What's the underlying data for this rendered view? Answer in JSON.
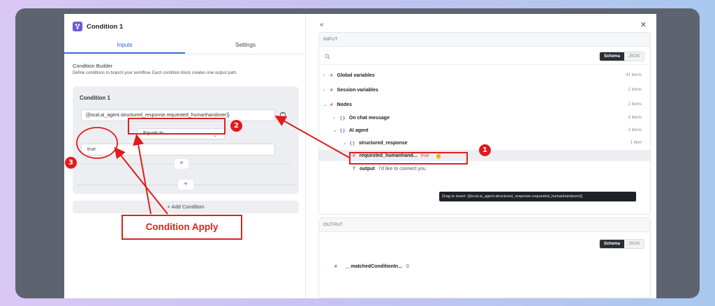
{
  "panel": {
    "title": "Condition 1",
    "tabs": [
      "Inputs",
      "Settings"
    ],
    "section_title": "Condition Builder",
    "section_desc": "Define conditions to branch your workflow. Each condition block creates one output path.",
    "condition_label": "Condition 1",
    "expression_value": "{{local.ai_agent.structured_response.requested_humanhandover}}",
    "operator_value": "Equals to",
    "compare_value": "true",
    "plus": "+",
    "add_condition": "+ Add Condition"
  },
  "input": {
    "header": "INPUT",
    "view_toggle": [
      "Schema",
      "JSON"
    ],
    "tree": [
      {
        "label": "Global variables",
        "count": "41 items"
      },
      {
        "label": "Session variables",
        "count": "2 items"
      },
      {
        "label": "Nodes",
        "count": "2 items"
      },
      {
        "label": "On chat message",
        "count": "4 items"
      },
      {
        "label": "AI agent",
        "count": "2 items"
      },
      {
        "label": "structured_response",
        "count": "1 item"
      },
      {
        "label": "requested_humanhand...",
        "value": "true"
      },
      {
        "label": "output",
        "value": "I'd like to connect you"
      }
    ],
    "tooltip": "Drag to insert: {{local.ai_agent.structured_response.requested_humanhandover}}"
  },
  "output": {
    "header": "OUTPUT",
    "view_toggle": [
      "Schema",
      "JSON"
    ],
    "field_label": "__matchedConditionIn...",
    "field_value": "0"
  },
  "annotations": {
    "badge_1": "1",
    "badge_2": "2",
    "badge_3": "3",
    "callout": "Condition Apply"
  },
  "colors": {
    "accent": "#3b6ef0",
    "annotation_red": "#e01b1b",
    "backdrop": "#5d6470"
  }
}
